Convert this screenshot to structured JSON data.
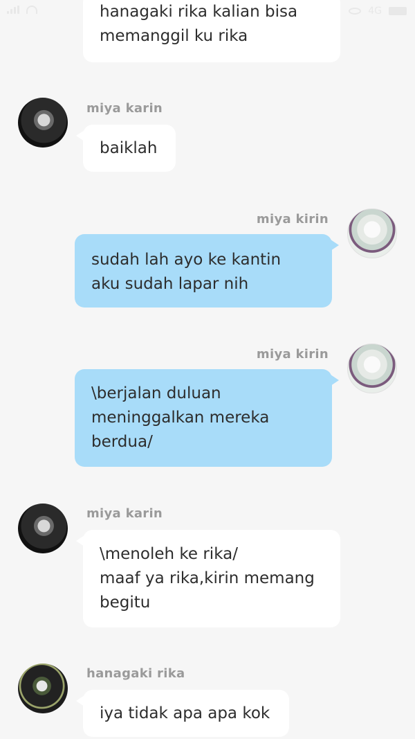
{
  "status_bar": {
    "carrier_text": "4G"
  },
  "messages": [
    {
      "sender": "",
      "lines": [
        "hanagaki rika kalian bisa",
        "memanggil ku rika"
      ]
    },
    {
      "sender": "miya karin",
      "lines": [
        "baiklah"
      ]
    },
    {
      "sender": "miya kirin",
      "lines": [
        "sudah lah ayo ke kantin",
        "aku sudah lapar nih"
      ]
    },
    {
      "sender": "miya kirin",
      "lines": [
        "\\berjalan duluan",
        "meninggalkan mereka",
        "berdua/"
      ]
    },
    {
      "sender": "miya karin",
      "lines": [
        "\\menoleh ke rika/",
        "maaf ya rika,kirin memang",
        "begitu"
      ]
    },
    {
      "sender": "hanagaki rika",
      "lines": [
        "iya tidak apa apa kok"
      ]
    }
  ]
}
